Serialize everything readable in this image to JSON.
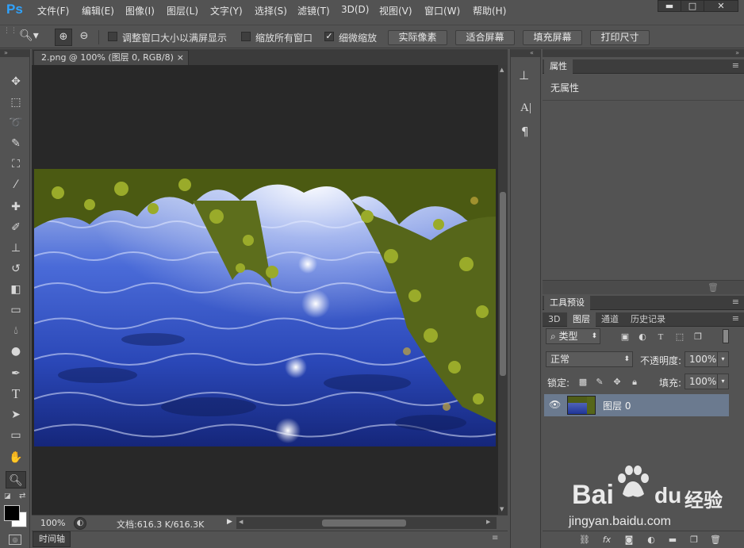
{
  "app": {
    "logo": "Ps"
  },
  "menubar": {
    "items": [
      "文件(F)",
      "编辑(E)",
      "图像(I)",
      "图层(L)",
      "文字(Y)",
      "选择(S)",
      "滤镜(T)",
      "3D(D)",
      "视图(V)",
      "窗口(W)",
      "帮助(H)"
    ],
    "window_controls": [
      "▬",
      "□",
      "✕"
    ]
  },
  "options": {
    "checkbox1_label": "调整窗口大小以满屏显示",
    "checkbox2_label": "缩放所有窗口",
    "checkbox3_label": "细微缩放",
    "btn_actual": "实际像素",
    "btn_fit": "适合屏幕",
    "btn_fill": "填充屏幕",
    "btn_print": "打印尺寸"
  },
  "document": {
    "tab_title": "2.png @ 100% (图层 0, RGB/8)",
    "tab_close": "×",
    "zoom": "100%",
    "doc_info": "文档:616.3 K/616.3K"
  },
  "timeline": {
    "label": "时间轴"
  },
  "properties": {
    "tab": "属性",
    "body": "无属性"
  },
  "tool_presets": {
    "tab": "工具预设"
  },
  "layers": {
    "tabs": [
      "3D",
      "图层",
      "通道",
      "历史记录"
    ],
    "filter_kind": "类型",
    "blend_mode": "正常",
    "opacity_label": "不透明度:",
    "opacity_value": "100%",
    "lock_label": "锁定:",
    "fill_label": "填充:",
    "fill_value": "100%",
    "layer_name": "图层 0"
  },
  "watermark": {
    "brand": "Bai",
    "brand2": "du",
    "brand_cn": "经验",
    "url": "jingyan.baidu.com"
  },
  "colors": {
    "accent_blue": "#2fa3ff",
    "selected_layer": "#6b7a8f"
  }
}
